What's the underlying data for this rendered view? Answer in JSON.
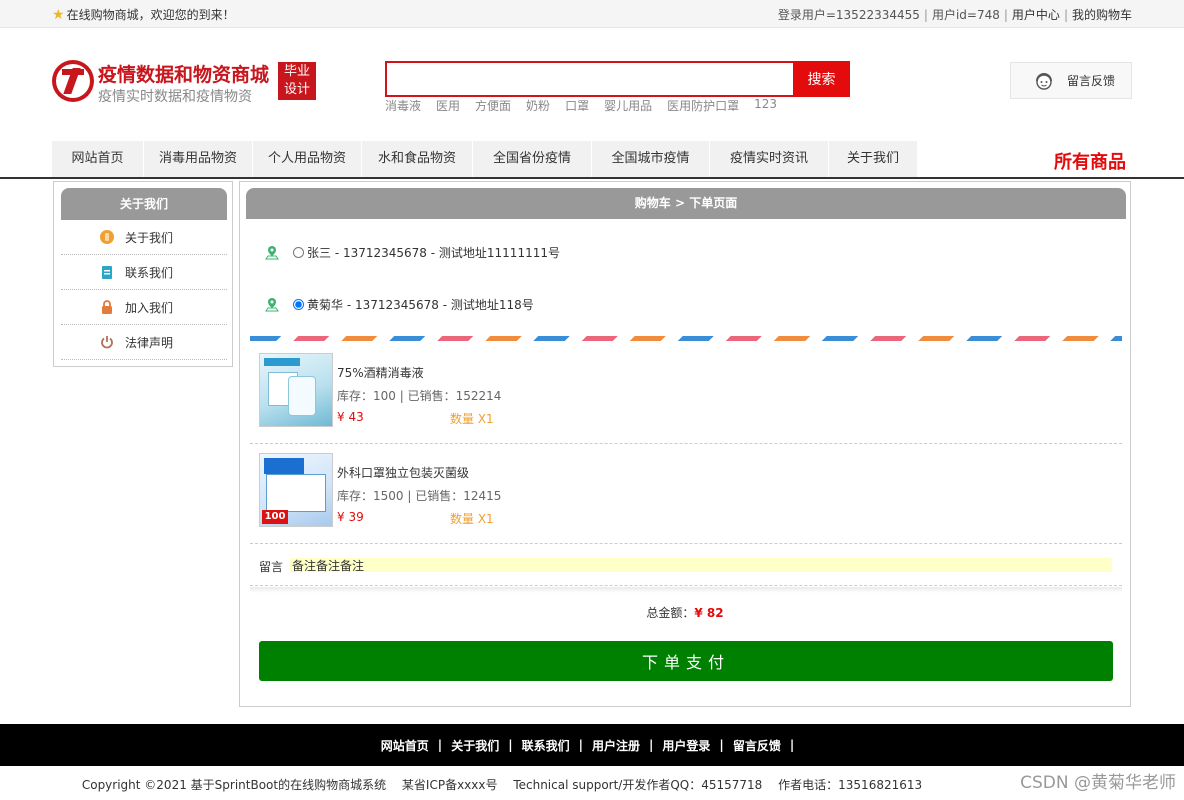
{
  "topbar": {
    "welcome": "在线购物商城，欢迎您的到来！",
    "user_label": "登录用户=13522334455",
    "userid_label": "用户id=748",
    "user_center": "用户中心",
    "my_cart": "我的购物车"
  },
  "header": {
    "logo_title": "疫情数据和物资商城",
    "logo_subtitle": "疫情实时数据和疫情物资",
    "badge_line1": "毕业",
    "badge_line2": "设计",
    "search_value": "",
    "search_button": "搜索",
    "hotwords": [
      "消毒液",
      "医用",
      "方便面",
      "奶粉",
      "口罩",
      "婴儿用品",
      "医用防护口罩",
      "123"
    ],
    "feedback": "留言反馈"
  },
  "nav": {
    "items": [
      "网站首页",
      "消毒用品物资",
      "个人用品物资",
      "水和食品物资",
      "全国省份疫情",
      "全国城市疫情",
      "疫情实时资讯",
      "关于我们"
    ],
    "all_goods": "所有商品"
  },
  "sidebar": {
    "title": "关于我们",
    "items": [
      "关于我们",
      "联系我们",
      "加入我们",
      "法律声明"
    ]
  },
  "main": {
    "title": "购物车 > 下单页面",
    "addresses": [
      {
        "text": "张三 - 13712345678 - 测试地址11111111号",
        "checked": false
      },
      {
        "text": "黄菊华 - 13712345678 - 测试地址118号",
        "checked": true
      }
    ],
    "products": [
      {
        "name": "75%酒精消毒液",
        "stock": "库存：100 | 已销售：152214",
        "price": "¥ 43",
        "qty": "数量 X1"
      },
      {
        "name": "外科口罩独立包装灭菌级",
        "stock": "库存：1500 | 已销售：12415",
        "price": "¥ 39",
        "qty": "数量 X1"
      }
    ],
    "note_label": "留言",
    "note_value": "备注备注备注",
    "total_label": "总金额：",
    "total_value": "¥ 82",
    "pay_button": "下单支付"
  },
  "footer": {
    "links": [
      "网站首页",
      "关于我们",
      "联系我们",
      "用户注册",
      "用户登录",
      "留言反馈"
    ],
    "copyright": "Copyright ©2021 基于SprintBoot的在线购物商城系统",
    "icp": "某省ICP备xxxx号",
    "support": "Technical support/开发作者QQ：45157718",
    "phone": "作者电话：13516821613"
  },
  "watermark": "CSDN @黄菊华老师",
  "colors": {
    "brand_red": "#c8161d",
    "search_red": "#e30b0b",
    "pay_green": "#008000",
    "panel_gray": "#999999"
  }
}
